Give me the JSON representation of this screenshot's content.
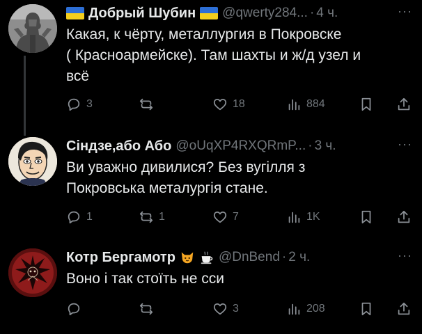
{
  "tweets": [
    {
      "name": "Добрый Шубин",
      "handle": "@qwerty284...",
      "time": "4 ч.",
      "more": "···",
      "text_lines": [
        "Какая, к чёрту, металлургия в Покровске",
        "( Красноармейске). Там шахты и ж/д узел и",
        "всё"
      ],
      "stats": {
        "replies": "3",
        "reposts": "",
        "likes": "18",
        "views": "884"
      }
    },
    {
      "name": "Сіндзе,або Або",
      "handle": "@oUqXP4RXQRmP...",
      "time": "3 ч.",
      "more": "···",
      "text_lines": [
        "Ви уважно дивилися? Без вугілля з",
        "Покровська металургія стане."
      ],
      "stats": {
        "replies": "1",
        "reposts": "1",
        "likes": "7",
        "views": "1K"
      }
    },
    {
      "name": "Котр Бергамотр",
      "handle": "@DnBend",
      "time": "2 ч.",
      "more": "···",
      "text_lines": [
        "Воно і так стоїть не сси"
      ],
      "stats": {
        "replies": "",
        "reposts": "",
        "likes": "3",
        "views": "208"
      }
    }
  ],
  "icons": {
    "reply": "speech-bubble-icon",
    "repost": "repost-arrows-icon",
    "like": "heart-icon",
    "views": "bar-chart-icon",
    "bookmark": "bookmark-icon",
    "share": "share-upload-icon"
  },
  "colors": {
    "background": "#000000",
    "text": "#e7e9ea",
    "muted": "#71767b",
    "thread_line": "#333639",
    "flag_blue": "#2d6fd6",
    "flag_yellow": "#f4cf1d"
  }
}
